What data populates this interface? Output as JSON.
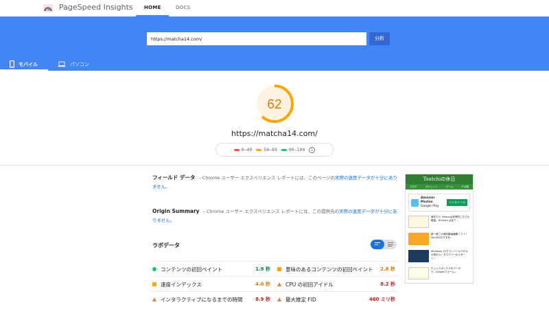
{
  "header": {
    "brand": "PageSpeed Insights",
    "tabs": [
      {
        "label": "HOME",
        "active": true
      },
      {
        "label": "DOCS",
        "active": false
      }
    ]
  },
  "search": {
    "value": "https://matcha14.com/",
    "button_label": "分析"
  },
  "device_tabs": [
    {
      "label": "モバイル",
      "icon": "smartphone-icon",
      "active": true
    },
    {
      "label": "パソコン",
      "icon": "laptop-icon",
      "active": false
    }
  ],
  "score": {
    "value": "62",
    "fraction": 0.62,
    "color": "#ffa400",
    "bg_color": "#fff3e0"
  },
  "tested_url": "https://matcha14.com/",
  "legend": [
    {
      "label": "0–49",
      "color": "#ff4e42"
    },
    {
      "label": "50–89",
      "color": "#ffa400"
    },
    {
      "label": "90–100",
      "color": "#0cce6b"
    }
  ],
  "field_data": {
    "title": "フィールド データ",
    "text": "– Chrome ユーザー エクスペリエンス レポートには、このページの",
    "link": "実際の速度データが十分にありません。"
  },
  "origin_summary": {
    "title": "Origin Summary",
    "text": "– Chrome ユーザー エクスペリエンス レポートには、この提供元の",
    "link": "実際の速度データが十分にありません。"
  },
  "lab_data": {
    "title": "ラボデータ",
    "metrics": [
      {
        "label": "コンテンツの初回ペイント",
        "value": "1.9 秒",
        "status": "pass"
      },
      {
        "label": "意味のあるコンテンツの初回ペイント",
        "value": "2.8 秒",
        "status": "average"
      },
      {
        "label": "速度インデックス",
        "value": "4.0 秒",
        "status": "average"
      },
      {
        "label": "CPU の初回アイドル",
        "value": "8.2 秒",
        "status": "fail"
      },
      {
        "label": "インタラクティブになるまでの時間",
        "value": "8.9 秒",
        "status": "fail"
      },
      {
        "label": "最大推定 FID",
        "value": "460 ミリ秒",
        "status": "fail"
      }
    ]
  },
  "thumbnail": {
    "site_title": "Tsutchiの休日",
    "nav": [
      "ブログ",
      "ガジェット",
      "ゲーム",
      "その他"
    ],
    "ad_title": "Amazon Photos",
    "ad_sub": "Google Play",
    "ad_button": "インストール",
    "articles": [
      "案外たら iPhoneは世界的にもでも軽量、Android は全て...",
      "新一般二の無料動画編集ソフト！Aviutlのおすすめ...",
      "Windows 10でコンソールパネルの表示入！タスクバーのスタート...",
      "チェックボックスをデータで...Googleフォーム..."
    ]
  }
}
